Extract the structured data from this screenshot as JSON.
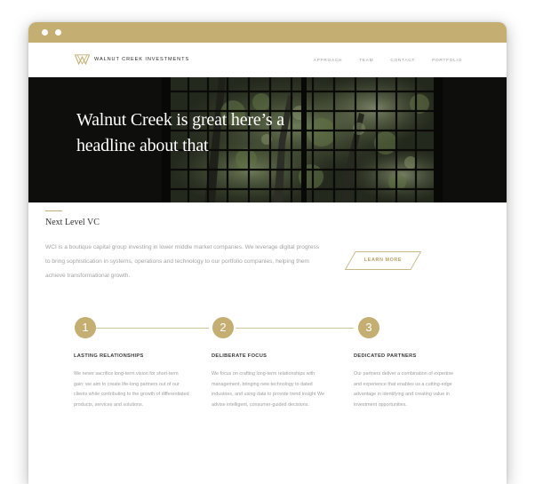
{
  "brand": {
    "name": "WALNUT CREEK INVESTMENTS",
    "accent_color": "#c4ae72"
  },
  "nav": {
    "items": [
      "APPROACH",
      "TEAM",
      "CONTACT",
      "PORTFOLIO"
    ]
  },
  "hero": {
    "headline_line1": "Walnut Creek is great here’s a",
    "headline_line2": "headline about that",
    "background": "dark window grid with green foliage photo"
  },
  "intro": {
    "title": "Next Level VC",
    "body": "WCI is a boutique capital group investing in lower middle market companies. We leverage digital progress to bring sophistication in systems, operations and technology to our portfolio companies, helping them achieve transformational growth.",
    "cta_label": "LEARN MORE"
  },
  "steps": [
    {
      "number": "1",
      "title": "LASTING RELATIONSHIPS",
      "body": "We never sacrifice long-term vision for short-term gain; we aim to create life-long partners out of our clients while contributing to the growth of differentiated products, services and solutions."
    },
    {
      "number": "2",
      "title": "DELIBERATE  FOCUS",
      "body": "We focus on crafting long-term relationships with management, bringing new technology to dated industries, and using data to provide trend insight We advise intelligent, consumer-guided decisions."
    },
    {
      "number": "3",
      "title": "DEDICATED PARTNERS",
      "body": "Our partners deliver a combination of expertise and experience that enables us a cutting-edge advantage in identifying and creating value in investment opportunities."
    }
  ]
}
